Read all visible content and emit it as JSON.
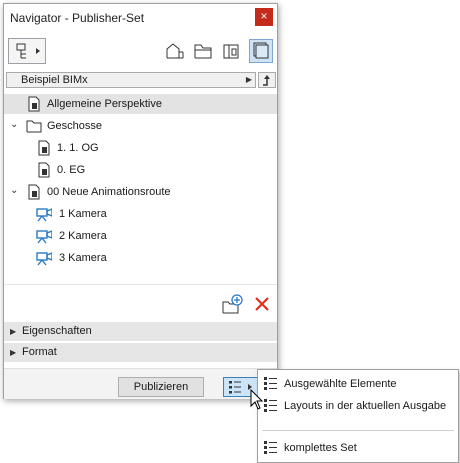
{
  "window": {
    "title": "Navigator - Publisher-Set",
    "close_symbol": "×"
  },
  "path": {
    "label": "Beispiel BIMx"
  },
  "tree": [
    {
      "label": "Allgemeine Perspektive",
      "icon": "file-icon",
      "selected": true
    },
    {
      "label": "Geschosse",
      "icon": "folder-icon",
      "expanded": true
    },
    {
      "label": "1. 1. OG",
      "icon": "file-icon"
    },
    {
      "label": "0. EG",
      "icon": "file-icon"
    },
    {
      "label": "00 Neue Animationsroute",
      "icon": "file-icon",
      "expanded": true
    },
    {
      "label": "1 Kamera",
      "icon": "camera-icon"
    },
    {
      "label": "2 Kamera",
      "icon": "camera-icon"
    },
    {
      "label": "3 Kamera",
      "icon": "camera-icon"
    }
  ],
  "panels": {
    "properties": "Eigenschaften",
    "format": "Format"
  },
  "footer": {
    "publish_label": "Publizieren"
  },
  "menu": {
    "selected_elements": "Ausgewählte Elemente",
    "layouts_current": "Layouts in der aktuellen Ausgabe",
    "complete_set": "komplettes Set"
  },
  "colors": {
    "close": "#c42b1c",
    "accent": "#2a7ac4",
    "delete": "#e0301e"
  }
}
